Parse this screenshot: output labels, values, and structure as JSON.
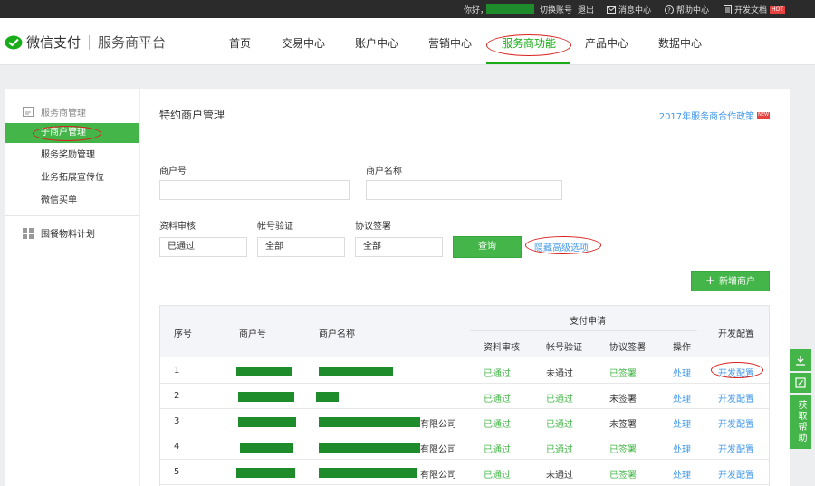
{
  "topbar": {
    "greeting": "你好，",
    "switch_account": "切换账号",
    "logout": "退出",
    "messages": "消息中心",
    "help": "帮助中心",
    "dev_docs": "开发文档",
    "hot_badge": "HOT"
  },
  "header": {
    "brand": "微信支付",
    "subtitle": "服务商平台",
    "nav": [
      "首页",
      "交易中心",
      "账户中心",
      "营销中心",
      "服务商功能",
      "产品中心",
      "数据中心"
    ],
    "active_nav": "服务商功能"
  },
  "sidebar": {
    "group1": "服务商管理",
    "items": [
      "子商户管理",
      "服务奖励管理",
      "业务拓展宣传位",
      "微信买单"
    ],
    "active_item": "子商户管理",
    "group2": "围餐物料计划"
  },
  "main": {
    "title": "特约商户管理",
    "policy_link": "2017年服务商合作政策",
    "policy_badge": "NEW",
    "filters": {
      "merchant_id_label": "商户号",
      "merchant_id_value": "",
      "merchant_name_label": "商户名称",
      "merchant_name_value": "",
      "review_label": "资料审核",
      "review_value": "已通过",
      "account_label": "帐号验证",
      "account_value": "全部",
      "agreement_label": "协议签署",
      "agreement_value": "全部",
      "query_button": "查询",
      "toggle_advanced": "隐藏高级选项"
    },
    "add_button": "新增商户",
    "table": {
      "headers": {
        "seq": "序号",
        "merchant_id": "商户号",
        "merchant_name": "商户名称",
        "pay_apply": "支付申请",
        "review": "资料审核",
        "account": "帐号验证",
        "agreement": "协议签署",
        "action": "操作",
        "dev": "开发配置"
      },
      "rows": [
        {
          "seq": "1",
          "name_suffix": "",
          "review": "已通过",
          "account": "未通过",
          "agreement": "已签署",
          "action": "处理",
          "dev": "开发配置"
        },
        {
          "seq": "2",
          "name_suffix": "",
          "review": "已通过",
          "account": "已通过",
          "agreement": "未签署",
          "action": "处理",
          "dev": "开发配置"
        },
        {
          "seq": "3",
          "name_suffix": "有限公司",
          "review": "已通过",
          "account": "已通过",
          "agreement": "未签署",
          "action": "处理",
          "dev": "开发配置"
        },
        {
          "seq": "4",
          "name_suffix": "有限公司",
          "review": "已通过",
          "account": "已通过",
          "agreement": "已签署",
          "action": "处理",
          "dev": "开发配置"
        },
        {
          "seq": "5",
          "name_suffix": "有限公司",
          "review": "已通过",
          "account": "未通过",
          "agreement": "已签署",
          "action": "处理",
          "dev": "开发配置"
        }
      ]
    }
  },
  "float_help": {
    "help_text": "获取帮助"
  },
  "colors": {
    "brand_green": "#44b549",
    "link_blue": "#459ae9",
    "annotation_red": "#d8231f",
    "topbar_bg": "#2b2b2b"
  }
}
